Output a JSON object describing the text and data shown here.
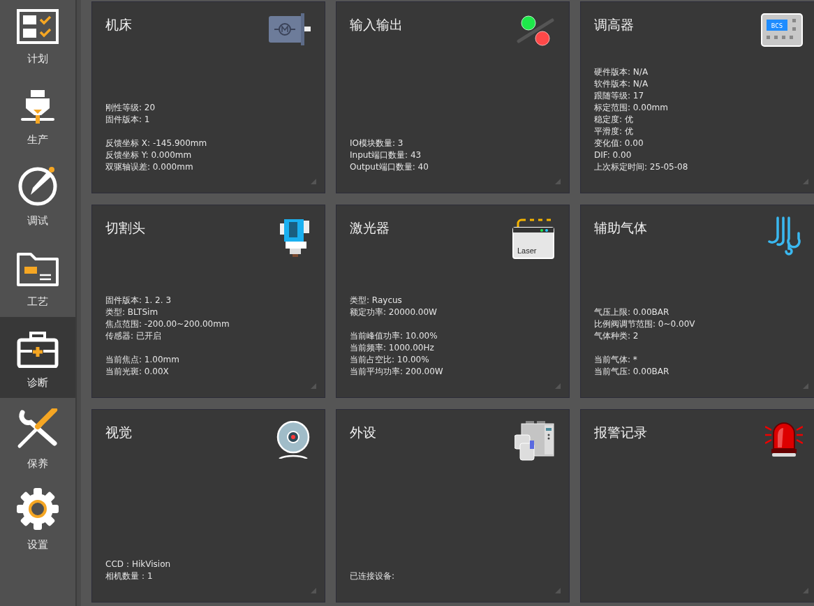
{
  "sidebar": {
    "items": [
      {
        "label": "计划",
        "selected": false
      },
      {
        "label": "生产",
        "selected": false
      },
      {
        "label": "调试",
        "selected": false
      },
      {
        "label": "工艺",
        "selected": false
      },
      {
        "label": "诊断",
        "selected": true
      },
      {
        "label": "保养",
        "selected": false
      },
      {
        "label": "设置",
        "selected": false
      }
    ]
  },
  "cards": [
    {
      "title": "机床",
      "info": [
        [
          "刚性等级: 20",
          "固件版本: 1"
        ],
        [
          "反馈坐标 X: -145.900mm",
          "反馈坐标 Y: 0.000mm",
          "双驱轴误差: 0.000mm"
        ]
      ]
    },
    {
      "title": "输入输出",
      "info": [
        [
          "IO模块数量: 3",
          "Input端口数量: 43",
          "Output端口数量: 40"
        ]
      ]
    },
    {
      "title": "调高器",
      "icon_text": "BCS",
      "info": [
        [
          "硬件版本: N/A",
          "软件版本: N/A",
          "跟随等级: 17",
          "标定范围: 0.00mm",
          "稳定度: 优",
          "平滑度: 优",
          "变化值: 0.00",
          "DIF: 0.00",
          "上次标定时间: 25-05-08"
        ]
      ]
    },
    {
      "title": "切割头",
      "info": [
        [
          "固件版本:  1. 2. 3",
          "类型: BLTSim",
          "焦点范围: -200.00~200.00mm",
          "传感器: 已开启"
        ],
        [
          "当前焦点: 1.00mm",
          "当前光斑: 0.00X"
        ]
      ]
    },
    {
      "title": "激光器",
      "icon_text": "Laser",
      "info": [
        [
          "类型: Raycus",
          "额定功率: 20000.00W"
        ],
        [
          "当前峰值功率: 10.00%",
          "当前频率: 1000.00Hz",
          "当前占空比: 10.00%",
          "当前平均功率: 200.00W"
        ]
      ]
    },
    {
      "title": "辅助气体",
      "info": [
        [
          "气压上限: 0.00BAR",
          "比例阀调节范围: 0~0.00V",
          "气体种类: 2"
        ],
        [
          "当前气体: *",
          "当前气压: 0.00BAR"
        ]
      ]
    },
    {
      "title": "视觉",
      "info": [
        [
          "CCD：HikVision",
          "相机数量：1"
        ]
      ]
    },
    {
      "title": "外设",
      "info": [
        [
          "已连接设备:"
        ]
      ]
    },
    {
      "title": "报警记录"
    }
  ]
}
